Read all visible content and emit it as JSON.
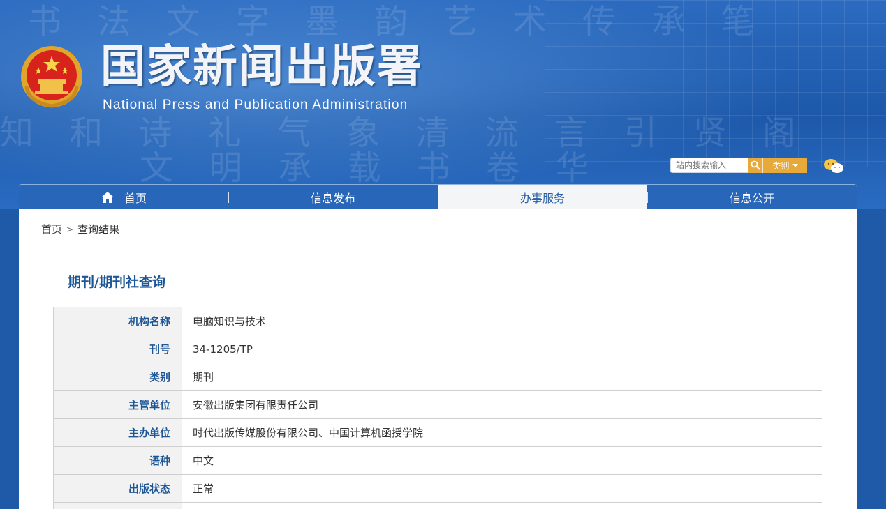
{
  "site": {
    "title_cn": "国家新闻出版署",
    "title_en": "National  Press and Publication Administration"
  },
  "search": {
    "placeholder": "站内搜索输入",
    "category_label": "类别"
  },
  "nav": {
    "items": [
      {
        "label": "首页"
      },
      {
        "label": "信息发布"
      },
      {
        "label": "办事服务"
      },
      {
        "label": "信息公开"
      }
    ]
  },
  "breadcrumb": {
    "home": "首页",
    "separator": ">",
    "current": "查询结果"
  },
  "page_title": "期刊/期刊社查询",
  "details": [
    {
      "label": "机构名称",
      "value": "电脑知识与技术"
    },
    {
      "label": "刊号",
      "value": "34-1205/TP"
    },
    {
      "label": "类别",
      "value": "期刊"
    },
    {
      "label": "主管单位",
      "value": "安徽出版集团有限责任公司"
    },
    {
      "label": "主办单位",
      "value": "时代出版传媒股份有限公司、中国计算机函授学院"
    },
    {
      "label": "语种",
      "value": "中文"
    },
    {
      "label": "出版状态",
      "value": "正常"
    }
  ],
  "colors": {
    "header_blue": "#1f5aa8",
    "nav_blue": "#2766b8",
    "label_blue": "#1d5797",
    "accent_orange": "#e6a93a"
  },
  "icons": [
    "national-emblem-icon",
    "search-icon",
    "caret-down-icon",
    "wechat-icon",
    "home-icon"
  ]
}
